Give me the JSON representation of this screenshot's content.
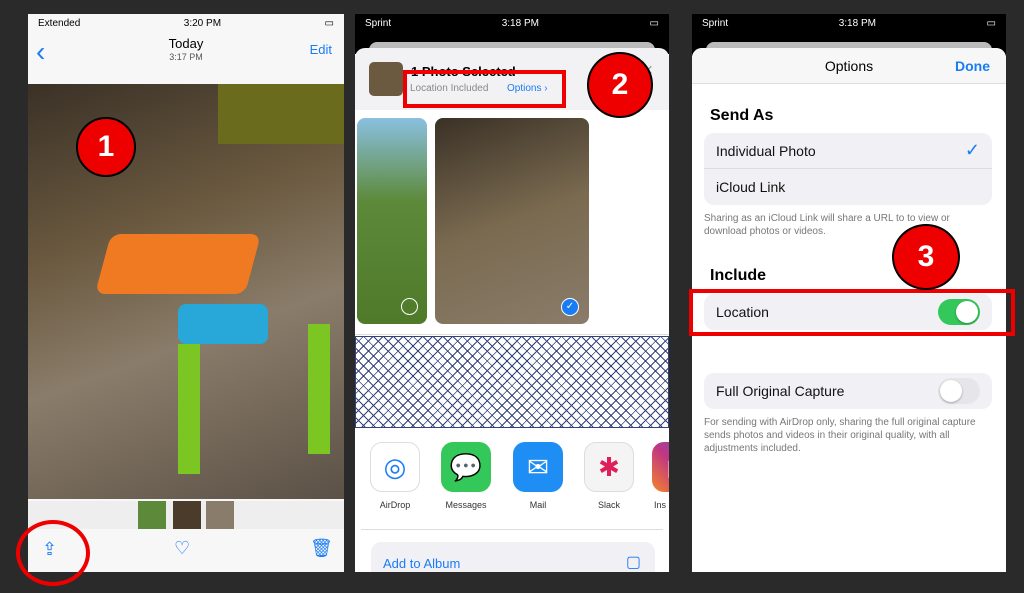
{
  "panel1": {
    "status": {
      "carrier": "Extended",
      "time": "3:20 PM"
    },
    "nav": {
      "back": "‹",
      "title": "Today",
      "subtitle": "3:17 PM",
      "edit": "Edit"
    },
    "step": "1",
    "toolbar": {
      "share": "share-icon",
      "favorite": "heart-icon",
      "delete": "trash-icon"
    }
  },
  "panel2": {
    "status": {
      "carrier": "Sprint",
      "time": "3:18 PM"
    },
    "header": {
      "title": "1 Photo Selected",
      "location": "Location Included",
      "options": "Options ›",
      "close": "×"
    },
    "step": "2",
    "apps": [
      {
        "label": "AirDrop",
        "icon": "◎",
        "color": "#ffffff"
      },
      {
        "label": "Messages",
        "icon": "💬",
        "color": "#34c759"
      },
      {
        "label": "Mail",
        "icon": "✉",
        "color": "#1e8ef5"
      },
      {
        "label": "Slack",
        "icon": "✱",
        "color": "#f4f4f4"
      },
      {
        "label": "Ins",
        "icon": "◻",
        "color": "#c13584"
      }
    ],
    "action": "Add to Album"
  },
  "panel3": {
    "status": {
      "carrier": "Sprint",
      "time": "3:18 PM"
    },
    "title": "Options",
    "done": "Done",
    "send_as": "Send As",
    "options": [
      {
        "label": "Individual Photo",
        "checked": true
      },
      {
        "label": "iCloud Link",
        "checked": false
      }
    ],
    "send_note": "Sharing as an iCloud Link will share a URL to to view or download photos or videos.",
    "include": "Include",
    "location": {
      "label": "Location",
      "on": true
    },
    "full_capture": {
      "label": "Full Original Capture",
      "on": false
    },
    "full_note": "For sending with AirDrop only, sharing the full original capture sends photos and videos in their original quality, with all adjustments included.",
    "step": "3",
    "accent": "#1a7cf5",
    "toggle_on": "#34c759"
  }
}
